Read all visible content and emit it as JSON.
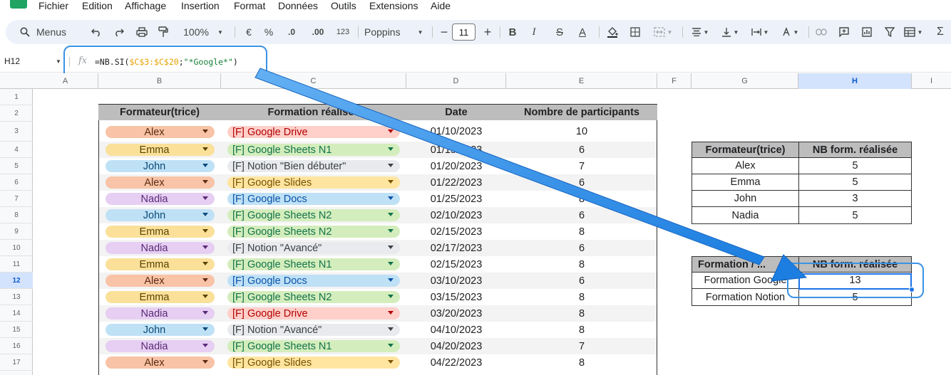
{
  "menu": [
    "Fichier",
    "Edition",
    "Affichage",
    "Insertion",
    "Format",
    "Données",
    "Outils",
    "Extensions",
    "Aide"
  ],
  "toolbar": {
    "search_label": "Menus",
    "zoom": "100%",
    "currency": "€",
    "percent": "%",
    "dec_decrease": ".0",
    "dec_increase": ".00",
    "number_format": "123",
    "font": "Poppins",
    "font_size": "11",
    "minus": "−",
    "plus": "+",
    "bold": "B",
    "italic": "I",
    "strike": "S",
    "text_color": "A",
    "sum": "Σ"
  },
  "formula_bar": {
    "cell_ref": "H12",
    "fx": "fx",
    "formula_prefix": "=NB.SI(",
    "formula_range": "$C$3:$C$20",
    "formula_sep": ";",
    "formula_criteria": "\"*Google*\"",
    "formula_suffix": ")"
  },
  "columns": [
    "A",
    "B",
    "C",
    "D",
    "E",
    "F",
    "G",
    "H",
    "I"
  ],
  "rows": [
    "1",
    "2",
    "3",
    "4",
    "5",
    "6",
    "7",
    "8",
    "9",
    "10",
    "11",
    "12",
    "13",
    "14",
    "15",
    "16",
    "17"
  ],
  "selected": {
    "column": "H",
    "row": "12"
  },
  "main_table": {
    "headers": [
      "Formateur(trice)",
      "Formation réalisée",
      "Date",
      "Nombre de participants"
    ],
    "rows": [
      {
        "person": "Alex",
        "formation": "[F] Google Drive",
        "date": "01/10/2023",
        "count": "10"
      },
      {
        "person": "Emma",
        "formation": "[F] Google Sheets N1",
        "date": "01/15/2023",
        "count": "6"
      },
      {
        "person": "John",
        "formation": "[F] Notion \"Bien débuter\"",
        "date": "01/20/2023",
        "count": "7"
      },
      {
        "person": "Alex",
        "formation": "[F] Google Slides",
        "date": "01/22/2023",
        "count": "6"
      },
      {
        "person": "Nadia",
        "formation": "[F] Google Docs",
        "date": "01/25/2023",
        "count": "8"
      },
      {
        "person": "John",
        "formation": "[F] Google Sheets N2",
        "date": "02/10/2023",
        "count": "6"
      },
      {
        "person": "Emma",
        "formation": "[F] Google Sheets N2",
        "date": "02/15/2023",
        "count": "8"
      },
      {
        "person": "Nadia",
        "formation": "[F] Notion \"Avancé\"",
        "date": "02/17/2023",
        "count": "6"
      },
      {
        "person": "Emma",
        "formation": "[F] Google Sheets N1",
        "date": "02/15/2023",
        "count": "8"
      },
      {
        "person": "Alex",
        "formation": "[F] Google Docs",
        "date": "03/10/2023",
        "count": "6"
      },
      {
        "person": "Emma",
        "formation": "[F] Google Sheets N2",
        "date": "03/15/2023",
        "count": "8"
      },
      {
        "person": "Nadia",
        "formation": "[F] Google Drive",
        "date": "03/20/2023",
        "count": "8"
      },
      {
        "person": "John",
        "formation": "[F] Notion \"Avancé\"",
        "date": "04/10/2023",
        "count": "8"
      },
      {
        "person": "Nadia",
        "formation": "[F] Google Sheets N1",
        "date": "04/20/2023",
        "count": "7"
      },
      {
        "person": "Alex",
        "formation": "[F] Google Slides",
        "date": "04/22/2023",
        "count": "8"
      }
    ]
  },
  "person_colors": {
    "Alex": {
      "bg": "#f8c3a6",
      "fg": "#5a2b14"
    },
    "Emma": {
      "bg": "#fbe09a",
      "fg": "#5a4300"
    },
    "John": {
      "bg": "#bfe1f6",
      "fg": "#0b4a7a"
    },
    "Nadia": {
      "bg": "#e6cff2",
      "fg": "#5a2a78"
    }
  },
  "formation_colors": {
    "[F] Google Drive": {
      "bg": "#ffcfc9",
      "fg": "#b10202"
    },
    "[F] Google Sheets N1": {
      "bg": "#d4edbc",
      "fg": "#11734b"
    },
    "[F] Google Sheets N2": {
      "bg": "#d4edbc",
      "fg": "#11734b"
    },
    "[F] Notion \"Bien débuter\"": {
      "bg": "#e8eaed",
      "fg": "#3c4043"
    },
    "[F] Notion \"Avancé\"": {
      "bg": "#e8eaed",
      "fg": "#3c4043"
    },
    "[F] Google Slides": {
      "bg": "#ffe5a0",
      "fg": "#7a5200"
    },
    "[F] Google Docs": {
      "bg": "#bfe1f6",
      "fg": "#0a53a8"
    }
  },
  "summary_people": {
    "headers": [
      "Formateur(trice)",
      "NB form. réalisée"
    ],
    "rows": [
      [
        "Alex",
        "5"
      ],
      [
        "Emma",
        "5"
      ],
      [
        "John",
        "3"
      ],
      [
        "Nadia",
        "5"
      ]
    ]
  },
  "summary_formation": {
    "headers": [
      "Formation / ...",
      "NB form. réalisée"
    ],
    "rows": [
      [
        "Formation Google",
        "13"
      ],
      [
        "Formation Notion",
        "5"
      ]
    ]
  },
  "accent_color": "#3a92e4"
}
